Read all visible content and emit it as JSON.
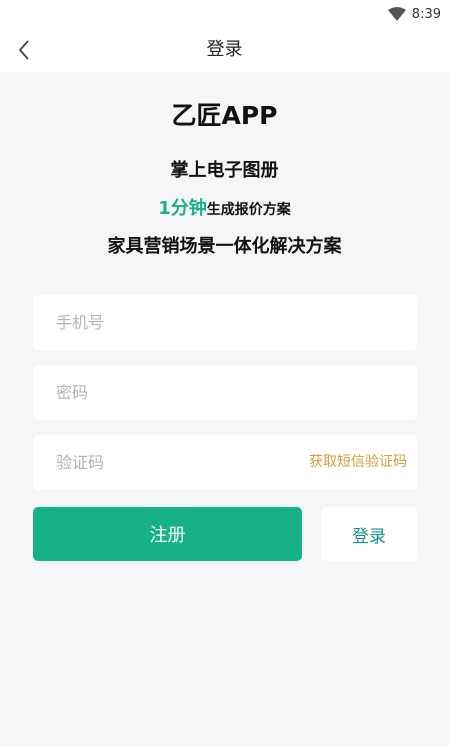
{
  "status_bar": {
    "time": "8:39",
    "wifi_icon": "wifi-icon"
  },
  "nav": {
    "back_icon": "chevron-left-icon",
    "title": "登录"
  },
  "hero": {
    "app_name": "乙匠APP",
    "tagline_1": "掌上电子图册",
    "tagline_2_highlight": "1分钟",
    "tagline_2_rest": "生成报价方案",
    "tagline_3": "家具营销场景一体化解决方案"
  },
  "form": {
    "phone_placeholder": "手机号",
    "password_placeholder": "密码",
    "code_placeholder": "验证码",
    "get_code_label": "获取短信验证码"
  },
  "actions": {
    "register_label": "注册",
    "login_label": "登录"
  },
  "colors": {
    "primary": "#16b187",
    "highlight": "#1bb08a",
    "sms_link": "#d99b3c",
    "login_text": "#1a8c8c",
    "background": "#f5f6f8"
  }
}
